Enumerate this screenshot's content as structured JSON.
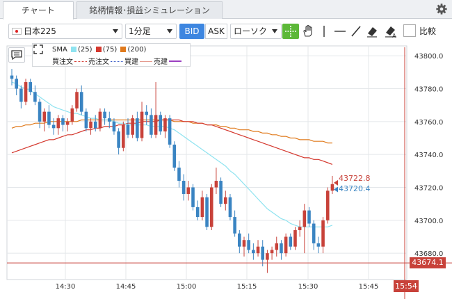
{
  "tabs": [
    {
      "label": "チャート"
    },
    {
      "label": "銘柄情報･損益シミュレーション"
    }
  ],
  "toolbar": {
    "instrument": "日本225",
    "interval": "1分足",
    "bid_label": "BID",
    "ask_label": "ASK",
    "chart_type": "ローソク",
    "compare_label": "比較",
    "tools": [
      "crosshair-icon",
      "hand-pan-icon",
      "vertical-line-icon",
      "horizontal-line-icon",
      "trendline-icon",
      "eraser-icon",
      "eraser-all-icon"
    ]
  },
  "legend": {
    "sma_label": "SMA",
    "sma_25": "(25)",
    "sma_75": "(75)",
    "sma_200": "(200)",
    "buy_order": "買注文",
    "sell_order": "売注文",
    "buy_position": "買建",
    "sell_position": "売建"
  },
  "colors": {
    "up": "#c8423a",
    "down": "#3a84c2",
    "sma25": "#8fe3f0",
    "sma75": "#d4382e",
    "sma200": "#e07a1c",
    "bid_active": "#3d86e0",
    "crosshair_active": "#5cb838"
  },
  "price_tags": {
    "ask": "43722.8",
    "bid": "43720.4",
    "current_line": "43674.1",
    "current_time": "15:54"
  },
  "chart_data": {
    "type": "candlestick",
    "y_ticks": [
      "43800.0",
      "43780.0",
      "43760.0",
      "43740.0",
      "43720.0",
      "43700.0",
      "43680.0"
    ],
    "y_tick_values": [
      43800,
      43780,
      43760,
      43740,
      43720,
      43700,
      43680
    ],
    "x_ticks": [
      "14:30",
      "14:45",
      "15:00",
      "15:15",
      "15:30",
      "15:45"
    ],
    "ylim": [
      43664,
      43806
    ],
    "xlim_minutes": [
      "14:16",
      "15:54"
    ],
    "grid": true,
    "candles_ohlc": [
      [
        43788,
        43792,
        43782,
        43786
      ],
      [
        43786,
        43788,
        43776,
        43780
      ],
      [
        43780,
        43782,
        43768,
        43772
      ],
      [
        43772,
        43786,
        43770,
        43784
      ],
      [
        43784,
        43786,
        43776,
        43778
      ],
      [
        43778,
        43782,
        43770,
        43772
      ],
      [
        43772,
        43774,
        43756,
        43760
      ],
      [
        43760,
        43768,
        43754,
        43766
      ],
      [
        43766,
        43770,
        43756,
        43758
      ],
      [
        43758,
        43762,
        43752,
        43756
      ],
      [
        43756,
        43764,
        43752,
        43762
      ],
      [
        43762,
        43764,
        43754,
        43758
      ],
      [
        43758,
        43762,
        43754,
        43760
      ],
      [
        43760,
        43770,
        43758,
        43768
      ],
      [
        43768,
        43780,
        43766,
        43778
      ],
      [
        43778,
        43782,
        43764,
        43766
      ],
      [
        43766,
        43768,
        43754,
        43756
      ],
      [
        43756,
        43762,
        43752,
        43760
      ],
      [
        43760,
        43764,
        43754,
        43756
      ],
      [
        43756,
        43768,
        43754,
        43766
      ],
      [
        43766,
        43768,
        43758,
        43762
      ],
      [
        43762,
        43766,
        43756,
        43760
      ],
      [
        43760,
        43762,
        43752,
        43754
      ],
      [
        43754,
        43756,
        43740,
        43744
      ],
      [
        43744,
        43760,
        43742,
        43758
      ],
      [
        43758,
        43762,
        43750,
        43752
      ],
      [
        43752,
        43764,
        43750,
        43762
      ],
      [
        43762,
        43766,
        43748,
        43750
      ],
      [
        43750,
        43772,
        43748,
        43766
      ],
      [
        43766,
        43770,
        43758,
        43764
      ],
      [
        43764,
        43768,
        43750,
        43752
      ],
      [
        43752,
        43784,
        43750,
        43764
      ],
      [
        43764,
        43766,
        43752,
        43754
      ],
      [
        43754,
        43764,
        43750,
        43762
      ],
      [
        43762,
        43764,
        43744,
        43746
      ],
      [
        43746,
        43748,
        43730,
        43732
      ],
      [
        43732,
        43736,
        43720,
        43724
      ],
      [
        43724,
        43728,
        43712,
        43716
      ],
      [
        43716,
        43724,
        43712,
        43720
      ],
      [
        43720,
        43722,
        43706,
        43708
      ],
      [
        43708,
        43712,
        43700,
        43702
      ],
      [
        43702,
        43718,
        43700,
        43714
      ],
      [
        43714,
        43716,
        43694,
        43696
      ],
      [
        43696,
        43722,
        43694,
        43720
      ],
      [
        43720,
        43732,
        43716,
        43724
      ],
      [
        43724,
        43726,
        43708,
        43710
      ],
      [
        43710,
        43718,
        43706,
        43714
      ],
      [
        43714,
        43716,
        43700,
        43702
      ],
      [
        43702,
        43706,
        43690,
        43692
      ],
      [
        43692,
        43694,
        43680,
        43684
      ],
      [
        43684,
        43690,
        43678,
        43688
      ],
      [
        43688,
        43692,
        43680,
        43682
      ],
      [
        43682,
        43686,
        43676,
        43680
      ],
      [
        43680,
        43688,
        43678,
        43684
      ],
      [
        43684,
        43688,
        43672,
        43676
      ],
      [
        43676,
        43682,
        43668,
        43680
      ],
      [
        43680,
        43684,
        43676,
        43682
      ],
      [
        43682,
        43690,
        43678,
        43686
      ],
      [
        43686,
        43688,
        43676,
        43680
      ],
      [
        43680,
        43692,
        43678,
        43690
      ],
      [
        43690,
        43692,
        43682,
        43684
      ],
      [
        43684,
        43696,
        43682,
        43694
      ],
      [
        43694,
        43700,
        43690,
        43696
      ],
      [
        43696,
        43710,
        43680,
        43706
      ],
      [
        43706,
        43708,
        43696,
        43698
      ],
      [
        43698,
        43700,
        43682,
        43686
      ],
      [
        43686,
        43690,
        43680,
        43684
      ],
      [
        43684,
        43702,
        43680,
        43700
      ],
      [
        43700,
        43720,
        43698,
        43718
      ],
      [
        43718,
        43727,
        43716,
        43722
      ]
    ],
    "sma25": [
      43784,
      43783,
      43781,
      43780,
      43779,
      43777,
      43775,
      43773,
      43771,
      43769,
      43768,
      43767,
      43766,
      43765,
      43765,
      43764,
      43763,
      43762,
      43762,
      43761,
      43761,
      43761,
      43760,
      43759,
      43759,
      43758,
      43758,
      43758,
      43758,
      43758,
      43757,
      43757,
      43757,
      43757,
      43756,
      43755,
      43753,
      43751,
      43749,
      43747,
      43745,
      43743,
      43741,
      43739,
      43737,
      43735,
      43733,
      43730,
      43728,
      43725,
      43722,
      43719,
      43716,
      43713,
      43710,
      43707,
      43705,
      43703,
      43701,
      43700,
      43698,
      43697,
      43696,
      43696,
      43696,
      43696,
      43696,
      43696,
      43696,
      43697
    ],
    "sma75": [
      43741,
      43742,
      43743,
      43744,
      43745,
      43746,
      43747,
      43748,
      43749,
      43749,
      43750,
      43751,
      43752,
      43752,
      43753,
      43754,
      43755,
      43755,
      43756,
      43756,
      43757,
      43757,
      43757,
      43758,
      43758,
      43759,
      43759,
      43759,
      43760,
      43760,
      43760,
      43760,
      43761,
      43761,
      43761,
      43761,
      43761,
      43760,
      43760,
      43760,
      43759,
      43759,
      43758,
      43758,
      43757,
      43756,
      43755,
      43754,
      43753,
      43752,
      43751,
      43750,
      43749,
      43748,
      43747,
      43746,
      43745,
      43744,
      43743,
      43742,
      43741,
      43740,
      43739,
      43738,
      43738,
      43737,
      43737,
      43736,
      43735,
      43734
    ],
    "sma200": [
      43756,
      43757,
      43757,
      43758,
      43758,
      43759,
      43759,
      43759,
      43760,
      43760,
      43760,
      43760,
      43760,
      43760,
      43760,
      43761,
      43761,
      43761,
      43761,
      43761,
      43761,
      43761,
      43761,
      43761,
      43761,
      43761,
      43761,
      43761,
      43761,
      43761,
      43761,
      43761,
      43761,
      43761,
      43761,
      43760,
      43760,
      43760,
      43760,
      43759,
      43759,
      43759,
      43758,
      43758,
      43758,
      43757,
      43757,
      43756,
      43756,
      43755,
      43755,
      43755,
      43754,
      43754,
      43753,
      43753,
      43752,
      43752,
      43751,
      43751,
      43750,
      43750,
      43749,
      43749,
      43749,
      43748,
      43748,
      43748,
      43747,
      43747
    ],
    "current_line_value": 43674.1,
    "series": [
      {
        "name": "(25)"
      },
      {
        "name": "(75)"
      },
      {
        "name": "(200)"
      }
    ]
  }
}
